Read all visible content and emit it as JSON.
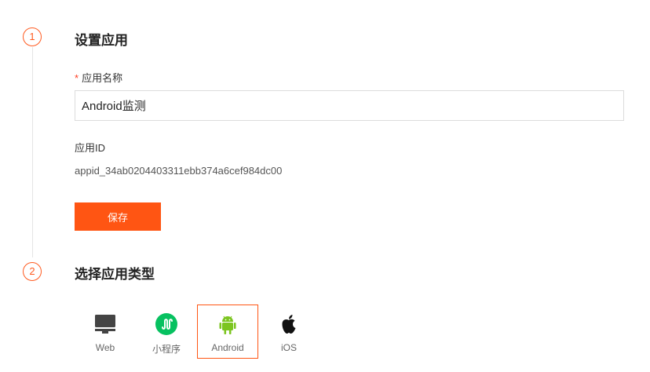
{
  "steps": [
    {
      "number": "1",
      "title": "设置应用"
    },
    {
      "number": "2",
      "title": "选择应用类型"
    }
  ],
  "form": {
    "required_mark": "*",
    "name_label": "应用名称",
    "name_value": "Android监测",
    "appid_label": "应用ID",
    "appid_value": "appid_34ab0204403311ebb374a6cef984dc00",
    "save_label": "保存"
  },
  "app_types": [
    {
      "label": "Web",
      "icon": "monitor-icon"
    },
    {
      "label": "小程序",
      "icon": "miniprogram-icon"
    },
    {
      "label": "Android",
      "icon": "android-icon"
    },
    {
      "label": "iOS",
      "icon": "apple-icon"
    }
  ],
  "selected_type": "Android",
  "colors": {
    "accent": "#ff5513",
    "wechat_green": "#07c160",
    "android_green": "#7cc520",
    "icon_dark": "#444444"
  }
}
